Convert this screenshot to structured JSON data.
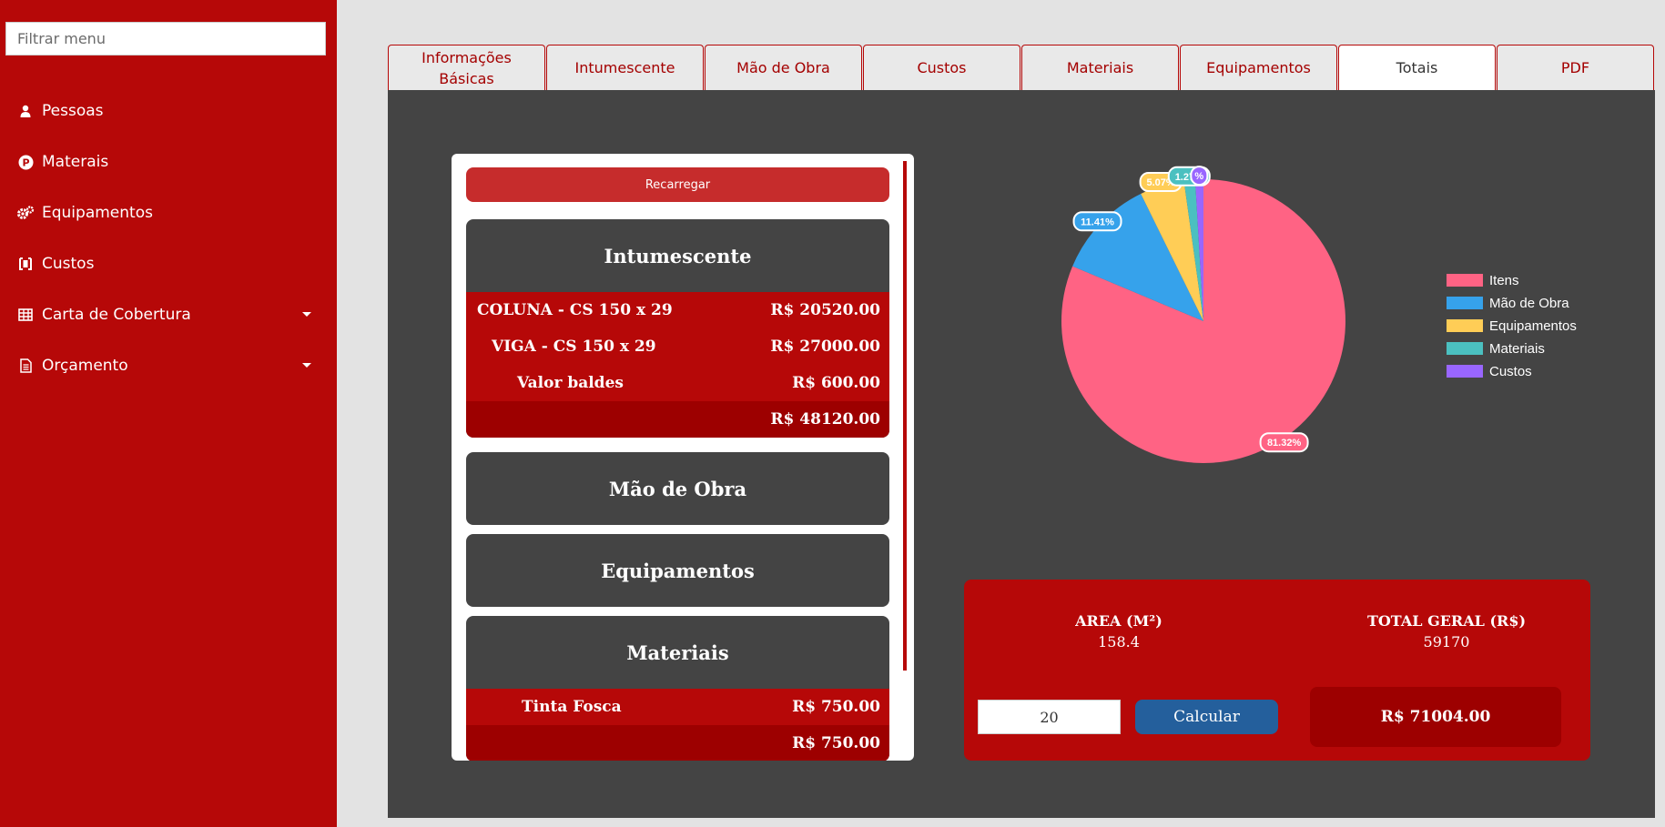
{
  "sidebar": {
    "filter_placeholder": "Filtrar menu",
    "items": [
      {
        "label": "Pessoas",
        "icon": "person-icon",
        "has_submenu": false
      },
      {
        "label": "Materais",
        "icon": "p-circle-icon",
        "has_submenu": false
      },
      {
        "label": "Equipamentos",
        "icon": "gears-icon",
        "has_submenu": false
      },
      {
        "label": "Custos",
        "icon": "money-icon",
        "has_submenu": false
      },
      {
        "label": "Carta de Cobertura",
        "icon": "table-icon",
        "has_submenu": true
      },
      {
        "label": "Orçamento",
        "icon": "document-icon",
        "has_submenu": true
      }
    ],
    "bg_color": "#b60808"
  },
  "tabs": [
    {
      "label": "Informações Básicas",
      "active": false
    },
    {
      "label": "Intumescente",
      "active": false
    },
    {
      "label": "Mão de Obra",
      "active": false
    },
    {
      "label": "Custos",
      "active": false
    },
    {
      "label": "Materiais",
      "active": false
    },
    {
      "label": "Equipamentos",
      "active": false
    },
    {
      "label": "Totais",
      "active": true
    },
    {
      "label": "PDF",
      "active": false
    }
  ],
  "summary": {
    "reload_label": "Recarregar",
    "intumescente": {
      "title": "Intumescente",
      "rows": [
        {
          "label": "COLUNA - CS 150 x 29",
          "value": "R$ 20520.00"
        },
        {
          "label": "VIGA - CS 150 x 29",
          "value": "R$ 27000.00"
        },
        {
          "label": "Valor baldes",
          "value": "R$ 600.00"
        }
      ],
      "total": "R$ 48120.00"
    },
    "mao_de_obra": {
      "title": "Mão de Obra"
    },
    "equipamentos": {
      "title": "Equipamentos"
    },
    "materiais": {
      "title": "Materiais",
      "rows": [
        {
          "label": "Tinta Fosca",
          "value": "R$ 750.00"
        }
      ],
      "total": "R$ 750.00"
    }
  },
  "chart_data": {
    "type": "pie",
    "categories": [
      "Itens",
      "Mão de Obra",
      "Equipamentos",
      "Materiais",
      "Custos"
    ],
    "values": [
      81.32,
      11.41,
      5.07,
      1.27,
      0.93
    ],
    "labels": [
      "81.32%",
      "11.41%",
      "5.07%",
      "1.27%",
      "%"
    ],
    "colors": [
      "#ff6384",
      "#36a2eb",
      "#ffcd56",
      "#4bc0c0",
      "#9966ff"
    ],
    "legend_position": "right"
  },
  "totals": {
    "area_label": "AREA (M²)",
    "area_value": "158.4",
    "total_label": "TOTAL GERAL (R$)",
    "total_value": "59170",
    "multiplier_value": "20",
    "calc_label": "Calcular",
    "result": "R$ 71004.00"
  }
}
